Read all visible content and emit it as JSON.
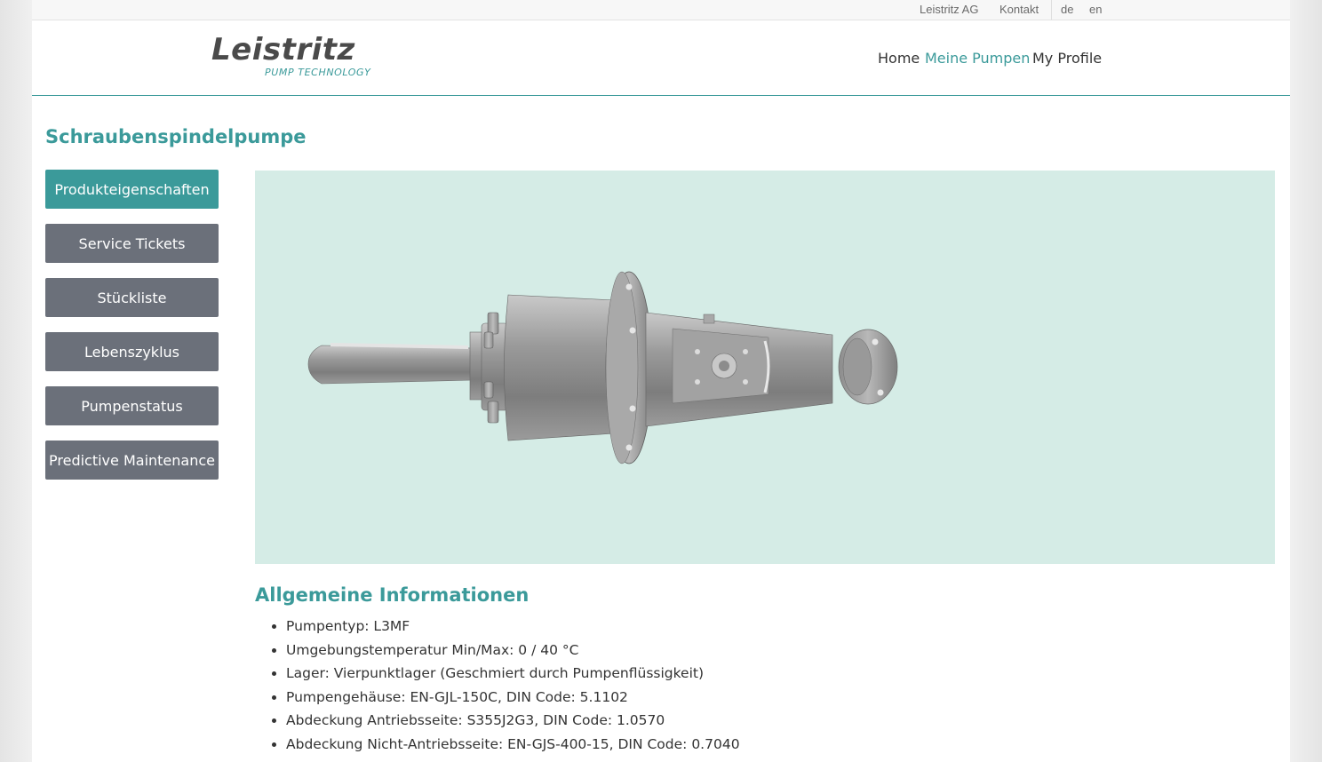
{
  "topbar": {
    "company": "Leistritz AG",
    "contact": "Kontakt",
    "lang_de": "de",
    "lang_en": "en"
  },
  "logo": {
    "name": "Leistritz",
    "tagline": "PUMP TECHNOLOGY"
  },
  "nav": {
    "home": "Home",
    "my_pumps": "Meine Pumpen",
    "my_profile": "My Profile"
  },
  "page_title": "Schraubenspindelpumpe",
  "sidebar": {
    "items": [
      {
        "label": "Produkteigenschaften",
        "active": true
      },
      {
        "label": "Service Tickets",
        "active": false
      },
      {
        "label": "Stückliste",
        "active": false
      },
      {
        "label": "Lebenszyklus",
        "active": false
      },
      {
        "label": "Pumpenstatus",
        "active": false
      },
      {
        "label": "Predictive Maintenance",
        "active": false
      }
    ]
  },
  "info": {
    "title": "Allgemeine Informationen",
    "items": [
      "Pumpentyp: L3MF",
      "Umgebungstemperatur Min/Max: 0 / 40 °C",
      "Lager: Vierpunktlager (Geschmiert durch Pumpenflüssigkeit)",
      "Pumpengehäuse: EN-GJL-150C, DIN Code: 5.1102",
      "Abdeckung Antriebsseite: S355J2G3, DIN Code: 1.0570",
      "Abdeckung Nicht-Antriebsseite: EN-GJS-400-15, DIN Code: 0.7040"
    ]
  },
  "colors": {
    "accent": "#3b9a9a",
    "button": "#6b707a",
    "viewer_bg": "#d5ece6"
  }
}
